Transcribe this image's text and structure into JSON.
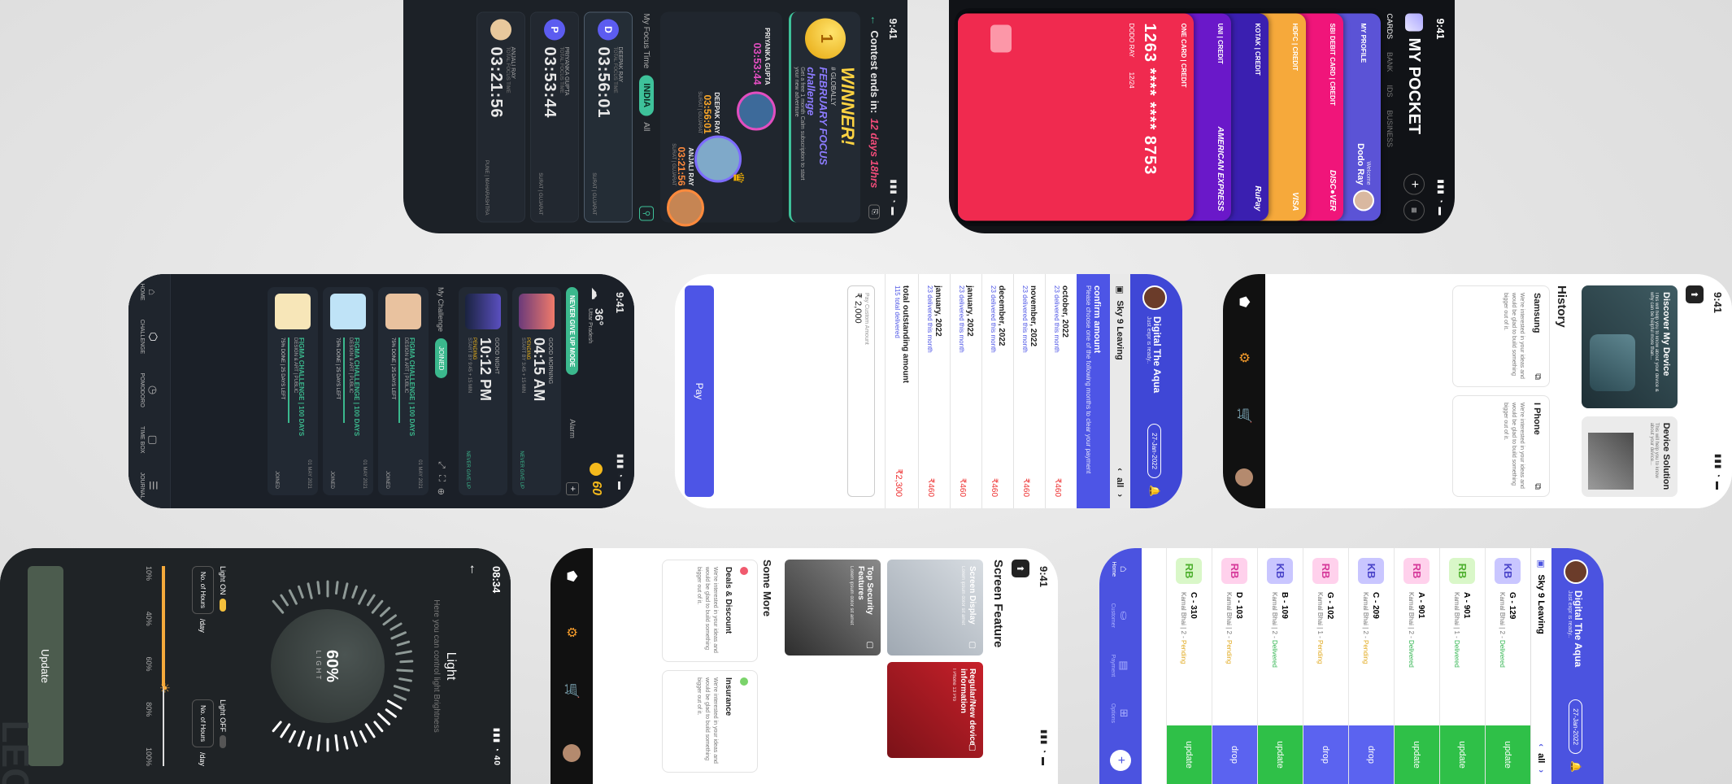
{
  "p1": {
    "time": "9:41",
    "contest": "Contest ends in:",
    "contest_time": "12 days 18hrs",
    "winner": "WINNER!",
    "globally": "# GLOBALLY",
    "challenge": "FEBRUARY FOCUS challenge",
    "prize": "Get a free 1 month Calm subscription to start your new adventure",
    "podium": [
      {
        "name": "PRIYANKA GUPTA",
        "time": "03:53:44"
      },
      {
        "name": "DEEPAK RAY",
        "time": "03:56:01",
        "sub": "SURAT | GUJARAT"
      },
      {
        "name": "ANJALI RAY",
        "time": "03:21:56",
        "sub": "SURAT | GUJARAT"
      }
    ],
    "tab_focus": "My Focus Time",
    "tab_india": "INDIA",
    "tab_all": "All",
    "cards": [
      {
        "initial": "D",
        "name": "DEEPAK RAY",
        "label": "TOTAL FOCUS TIME",
        "time": "03:56:01",
        "loc": "SURAT | GUJARAT"
      },
      {
        "initial": "P",
        "name": "PRIYANKA GUPTA",
        "label": "TOTAL FOCUS TIME",
        "time": "03:53:44",
        "loc": "SURAT | GUJARAT"
      },
      {
        "initial": "A",
        "name": "ANJALI RAY",
        "label": "TOTAL FOCUS TIME",
        "time": "03:21:56",
        "loc": "PUNE | MAHARASHTRA"
      }
    ]
  },
  "p2": {
    "time": "9:41",
    "title": "MY POCKET",
    "tabs": [
      "CARDS",
      "BANK",
      "IDS",
      "BUSINESS"
    ],
    "welcome": "Welcome",
    "user": "Dodo Ray",
    "cards": [
      {
        "label": "MY PROFILE",
        "color": "#5b53d6"
      },
      {
        "label": "SBI DEBIT CARD | CREDIT",
        "color": "#f0157a",
        "brand": "DISC●VER"
      },
      {
        "label": "HDFC | CREDIT",
        "color": "#f6a93b",
        "brand": "VISA"
      },
      {
        "label": "KOTAK | CREDIT",
        "color": "#3a1fb0",
        "brand": "RuPay"
      },
      {
        "label": "UNI | CREDIT",
        "color": "#6a18c9",
        "brand": "AMERICAN EXPRESS"
      },
      {
        "label": "ONE CARD | CREDIT",
        "color": "#f02a4f"
      }
    ],
    "card_number": "1263 **** **** 8753",
    "card_holder": "DODO RAY",
    "card_exp": "12/24"
  },
  "p3": {
    "time": "9:41",
    "temp": "36°",
    "location": "Uttar Pradesh",
    "coins": "60",
    "never_mode": "NEVER GIVE UP MODE",
    "alarm": "Alarm",
    "alarms": [
      {
        "greet": "GOOD MORNING",
        "time": "04:15 AM",
        "label": "PENDING",
        "note": "START BY 3:45 + 15 MIN",
        "tag": "NEVER GIVE UP"
      },
      {
        "greet": "GOOD NIGHT",
        "time": "10:12 PM",
        "label": "PENDING",
        "note": "START BY 9:45 + 15 MIN",
        "tag": "NEVER GIVE UP"
      }
    ],
    "my_challenge": "My Challenge",
    "joined": "JOINED",
    "challenges": [
      {
        "title": "FIGMA CHALLENGE | 100 DAYS",
        "sub": "DESIGN & ART | PUBLIC",
        "days": "75% DONE | 25 DAYS LEFT",
        "date": "01 MAY 2021",
        "joined": "JOINED"
      },
      {
        "title": "FIGMA CHALLENGE | 100 DAYS",
        "sub": "DESIGN & ART | PUBLIC",
        "days": "75% DONE | 25 DAYS LEFT",
        "date": "01 MAY 2021",
        "joined": "JOINED"
      },
      {
        "title": "FIGMA CHALLENGE | 100 DAYS",
        "sub": "DESIGN & ART | PUBLIC",
        "days": "75% DONE | 25 DAYS LEFT",
        "date": "01 MAY 2021",
        "joined": "JOINED"
      }
    ],
    "nav": [
      "HOME",
      "CHALLENGE",
      "POMODORO",
      "TIME BOX",
      "JOURNAL"
    ]
  },
  "p4": {
    "app": "Digital The Aqua",
    "app_sub": "Just expr is ready..",
    "date": "27-Jan-2022",
    "unit": "Sky 9 Leaving",
    "tab_all": "all",
    "confirm": "confirm amount",
    "confirm_sub": "Please choose one of the following months to clear your payment",
    "months": [
      {
        "m": "october, 2022",
        "d": "23 delivered this month",
        "a": "₹460"
      },
      {
        "m": "november, 2022",
        "d": "23 delivered this month",
        "a": "₹460"
      },
      {
        "m": "december, 2022",
        "d": "23 delivered this month",
        "a": "₹460"
      },
      {
        "m": "january, 2022",
        "d": "23 delivered this month",
        "a": "₹460"
      },
      {
        "m": "january, 2022",
        "d": "23 delivered this month",
        "a": "₹460"
      }
    ],
    "total": "total outstanding amount",
    "total_d": "115 total delivered",
    "total_a": "₹2,300",
    "custom_label": "Pay Custom Amount",
    "custom_value": "₹ 2,000",
    "pay": "Pay"
  },
  "p5": {
    "time": "9:41",
    "discover": "Discover My Device",
    "discover_sub": "This will help you to know about your device & why can be helpful more than...",
    "device_solution": "Device Solution",
    "device_solution_sub": "This will help you to know about your device...",
    "history": "History",
    "items": [
      {
        "name": "Samsung",
        "desc": "We're interested in your ideas and would be glad to build something bigger out of it."
      },
      {
        "name": "I Phone",
        "desc": "We're interested in your ideas and would be glad to build something bigger out of it."
      }
    ]
  },
  "p6": {
    "time": "08:34",
    "title": "Light",
    "subtitle": "Here you can control light Brightness",
    "percent": "60%",
    "dial_label": "LIGHT",
    "light_on": "Light ON",
    "light_off": "Light OFF",
    "hours": "No. of Hours",
    "per_day": "/day",
    "scale": [
      "10%",
      "40%",
      "60%",
      "80%",
      "100%"
    ],
    "update": "Update",
    "brand": "LEO"
  },
  "p7": {
    "time": "9:41",
    "title": "Screen Feature",
    "cards": [
      {
        "title": "Screen Display",
        "sub": "Lorem ipsum dolor sit amet"
      },
      {
        "title": "Regular/New device information",
        "sub": "I Phone 13 Pro"
      },
      {
        "title": "Top Security Features",
        "sub": "Lorem ipsum dolor sit amet"
      }
    ],
    "some_more": "Some More",
    "more": [
      {
        "title": "Deals & Discount",
        "desc": "We're interested in your ideas and would be glad to build something bigger out of it.",
        "dot": "#f05a6e"
      },
      {
        "title": "Insurance",
        "desc": "We're interested in your ideas and would be glad to build something bigger out of it.",
        "dot": "#7ad36a"
      }
    ]
  },
  "p8": {
    "app": "Digital The Aqua",
    "app_sub": "Just expr is ready..",
    "date": "27-Jan-2022",
    "unit": "Sky 9 Leaving",
    "tab_all": "all",
    "rows": [
      {
        "tag": "KB",
        "code": "G - 129",
        "who": "Kamal Bhai",
        "qty": "2",
        "status": "Delivered",
        "action": "update",
        "tagc": "#c9c6ff",
        "tagt": "#4a44c9",
        "sc": "#2fb44e",
        "ac": "#2fc048"
      },
      {
        "tag": "RB",
        "code": "A - 901",
        "who": "Kamal Bhai",
        "qty": "1",
        "status": "Delivered",
        "action": "update",
        "tagc": "#d9f7c8",
        "tagt": "#4fb02f",
        "sc": "#2fb44e",
        "ac": "#2fc048"
      },
      {
        "tag": "RB",
        "code": "A - 901",
        "who": "Kamal Bhai",
        "qty": "2",
        "status": "Delivered",
        "action": "update",
        "tagc": "#ffd1ec",
        "tagt": "#d63a9a",
        "sc": "#2fb44e",
        "ac": "#2fc048"
      },
      {
        "tag": "KB",
        "code": "C - 209",
        "who": "Kamal Bhai",
        "qty": "2",
        "status": "Pending",
        "action": "drop",
        "tagc": "#c9c6ff",
        "tagt": "#4a44c9",
        "sc": "#e0a81b",
        "ac": "#5b63f0"
      },
      {
        "tag": "RB",
        "code": "G - 102",
        "who": "Kamal Bhai",
        "qty": "1",
        "status": "Pending",
        "action": "drop",
        "tagc": "#ffd1ec",
        "tagt": "#d63a9a",
        "sc": "#e0a81b",
        "ac": "#5b63f0"
      },
      {
        "tag": "KB",
        "code": "B - 109",
        "who": "Kamal Bhai",
        "qty": "2",
        "status": "Delivered",
        "action": "update",
        "tagc": "#c9c6ff",
        "tagt": "#4a44c9",
        "sc": "#2fb44e",
        "ac": "#2fc048"
      },
      {
        "tag": "RB",
        "code": "D - 103",
        "who": "Kamal Bhai",
        "qty": "2",
        "status": "Pending",
        "action": "drop",
        "tagc": "#ffd1ec",
        "tagt": "#d63a9a",
        "sc": "#e0a81b",
        "ac": "#5b63f0"
      },
      {
        "tag": "RB",
        "code": "C - 310",
        "who": "Kamal Bhai",
        "qty": "2",
        "status": "Pending",
        "action": "update",
        "tagc": "#d9f7c8",
        "tagt": "#4fb02f",
        "sc": "#e0a81b",
        "ac": "#2fc048"
      }
    ],
    "nav": [
      "Home",
      "Customer",
      "Payment",
      "Options"
    ]
  }
}
